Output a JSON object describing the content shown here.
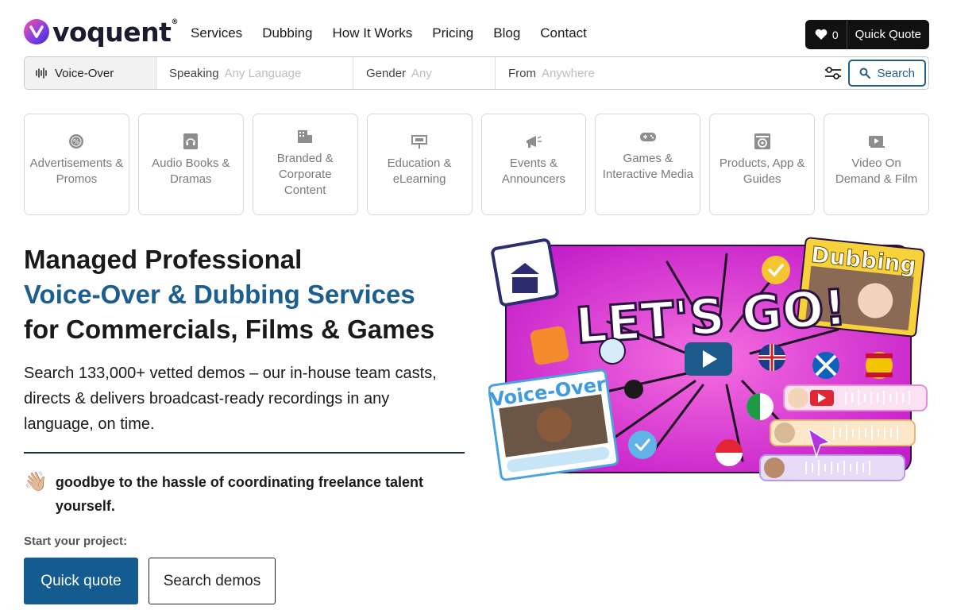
{
  "brand": {
    "name": "voquent",
    "tm": "®"
  },
  "nav": [
    "Services",
    "Dubbing",
    "How It Works",
    "Pricing",
    "Blog",
    "Contact"
  ],
  "header": {
    "favorites_count": "0",
    "quick_quote": "Quick Quote"
  },
  "search": {
    "type_label": "Voice-Over",
    "speaking_label": "Speaking",
    "speaking_placeholder": "Any Language",
    "gender_label": "Gender",
    "gender_placeholder": "Any",
    "from_label": "From",
    "from_placeholder": "Anywhere",
    "button": "Search"
  },
  "categories": [
    {
      "label": "Advertisements & Promos",
      "icon": "badge-percent-icon"
    },
    {
      "label": "Audio Books & Dramas",
      "icon": "audiobook-icon"
    },
    {
      "label": "Branded & Corporate Content",
      "icon": "corporate-icon"
    },
    {
      "label": "Education & eLearning",
      "icon": "presentation-icon"
    },
    {
      "label": "Events & Announcers",
      "icon": "megaphone-icon"
    },
    {
      "label": "Games & Interactive Media",
      "icon": "gamepad-icon"
    },
    {
      "label": "Products, App & Guides",
      "icon": "product-guide-icon"
    },
    {
      "label": "Video On Demand & Film",
      "icon": "video-icon"
    }
  ],
  "hero": {
    "line1": "Managed Professional",
    "line2": "Voice-Over & Dubbing Services",
    "line3": "for Commercials, Films & Games",
    "description": "Search 133,000+ vetted demos – our in-house team casts, directs & delivers broadcast-ready recordings in any language, on time.",
    "goodbye_icon": "👋🏼",
    "goodbye": "goodbye to the hassle of coordinating freelance talent yourself.",
    "start_label": "Start your project:",
    "cta_primary": "Quick quote",
    "cta_secondary": "Search demos"
  },
  "art": {
    "headline": "LET'S GO!",
    "badge_dubbing": "Dubbing",
    "badge_voiceover": "Voice-Over"
  },
  "colors": {
    "accent": "#1a5f8f",
    "primary_button": "#145b8f",
    "art_pink": "#e83fd6"
  }
}
